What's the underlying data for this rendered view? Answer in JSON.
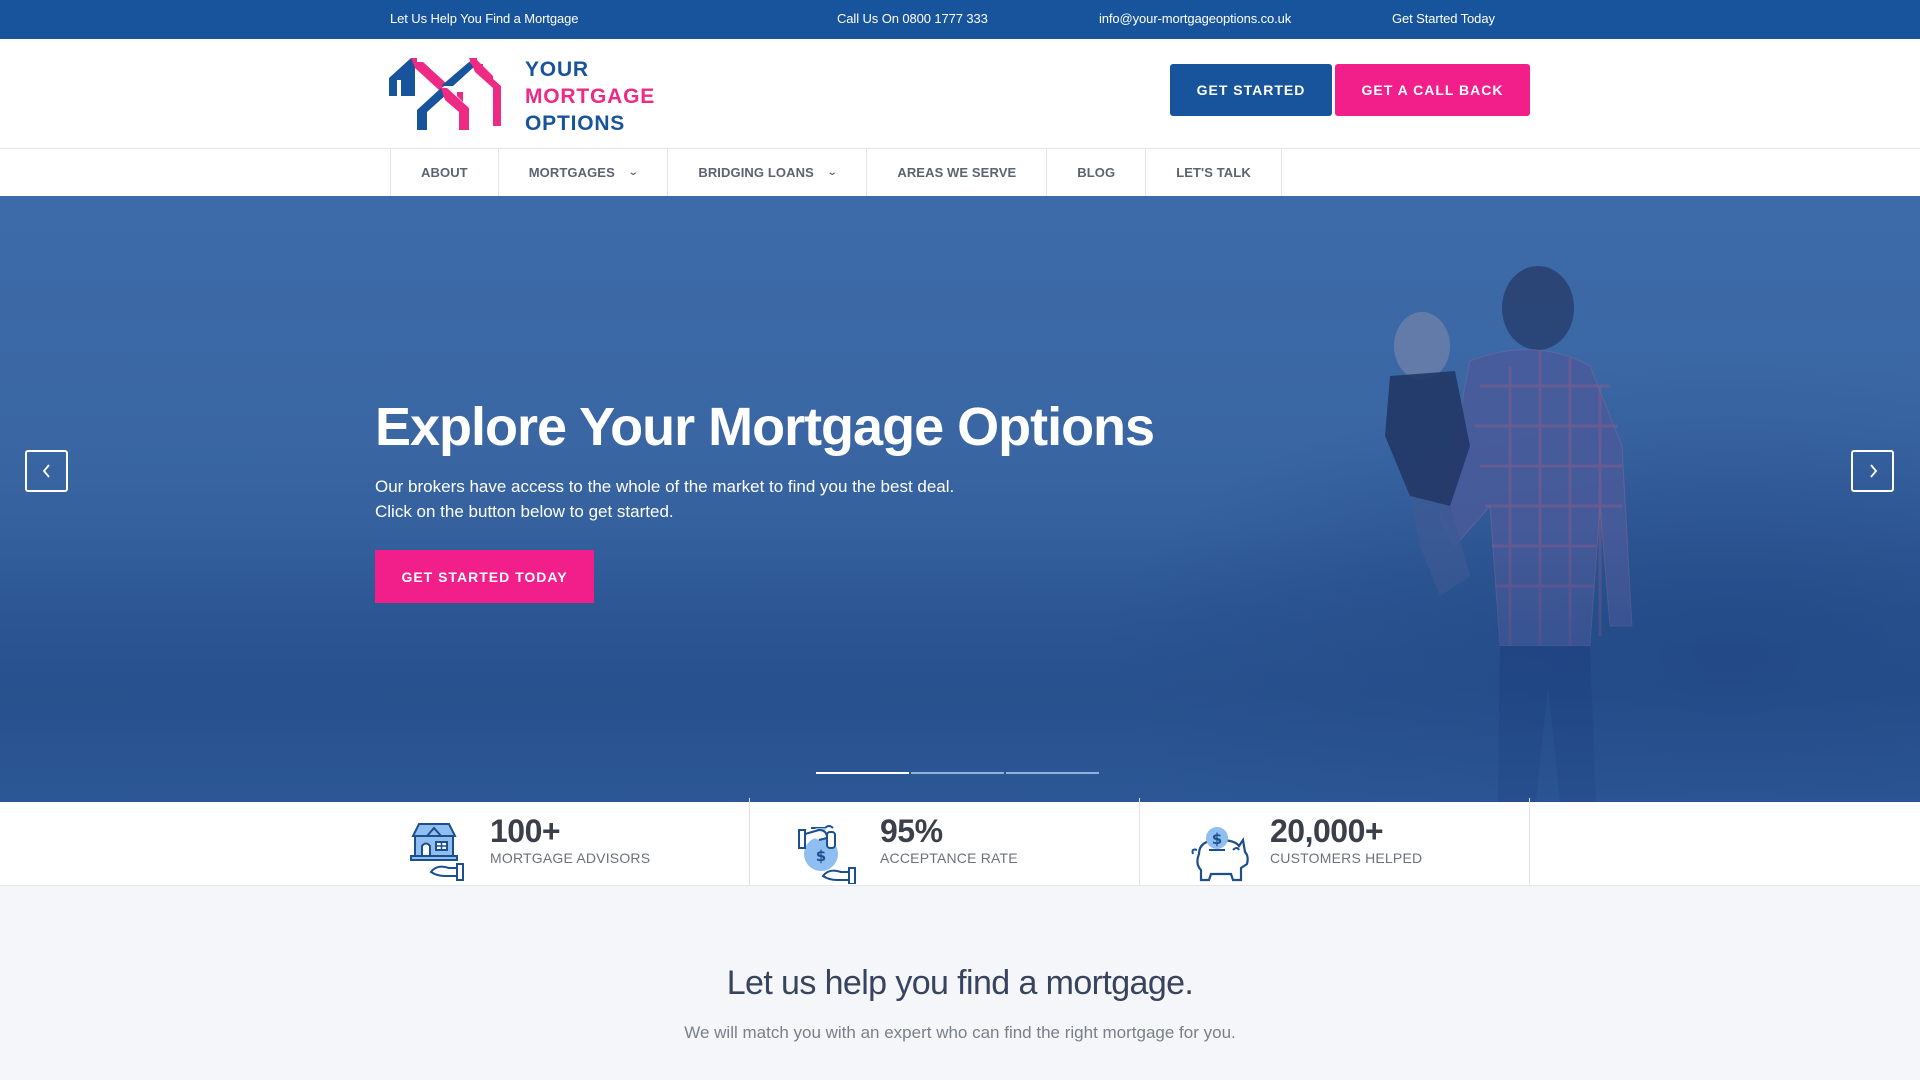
{
  "topbar": {
    "tagline": "Let Us Help You Find a Mortgage",
    "phone": "Call Us On 0800 1777 333",
    "email": "info@your-mortgageoptions.co.uk",
    "cta": "Get Started Today"
  },
  "brand": {
    "line1": "YOUR",
    "line2": "MORTGAGE",
    "line3": "OPTIONS",
    "colors": {
      "primary": "#18549c",
      "accent": "#f21f8a"
    }
  },
  "header": {
    "get_started": "GET STARTED",
    "call_back": "GET A CALL BACK"
  },
  "nav": {
    "items": [
      {
        "label": "ABOUT",
        "has_dropdown": false
      },
      {
        "label": "MORTGAGES",
        "has_dropdown": true
      },
      {
        "label": "BRIDGING LOANS",
        "has_dropdown": true
      },
      {
        "label": "AREAS WE SERVE",
        "has_dropdown": false
      },
      {
        "label": "BLOG",
        "has_dropdown": false
      },
      {
        "label": "LET'S TALK",
        "has_dropdown": false
      }
    ],
    "chevron": "⌄"
  },
  "hero": {
    "title": "Explore Your Mortgage Options",
    "subtitle_line1": "Our brokers have access to the whole of the market to find you the best deal.",
    "subtitle_line2": "Click on the button below to get started.",
    "button": "GET STARTED TODAY",
    "prev_icon": "‹",
    "next_icon": "›",
    "slides_total": 3,
    "active_slide": 1
  },
  "stats": [
    {
      "value": "100+",
      "label": "MORTGAGE ADVISORS",
      "icon": "house-in-hand-icon"
    },
    {
      "value": "95%",
      "label": "ACCEPTANCE RATE",
      "icon": "money-bag-hand-icon"
    },
    {
      "value": "20,000+",
      "label": "CUSTOMERS HELPED",
      "icon": "piggy-bank-icon"
    }
  ],
  "intro": {
    "title": "Let us help you find a mortgage.",
    "subtitle": "We will match you with an expert who can find the right mortgage for you."
  }
}
